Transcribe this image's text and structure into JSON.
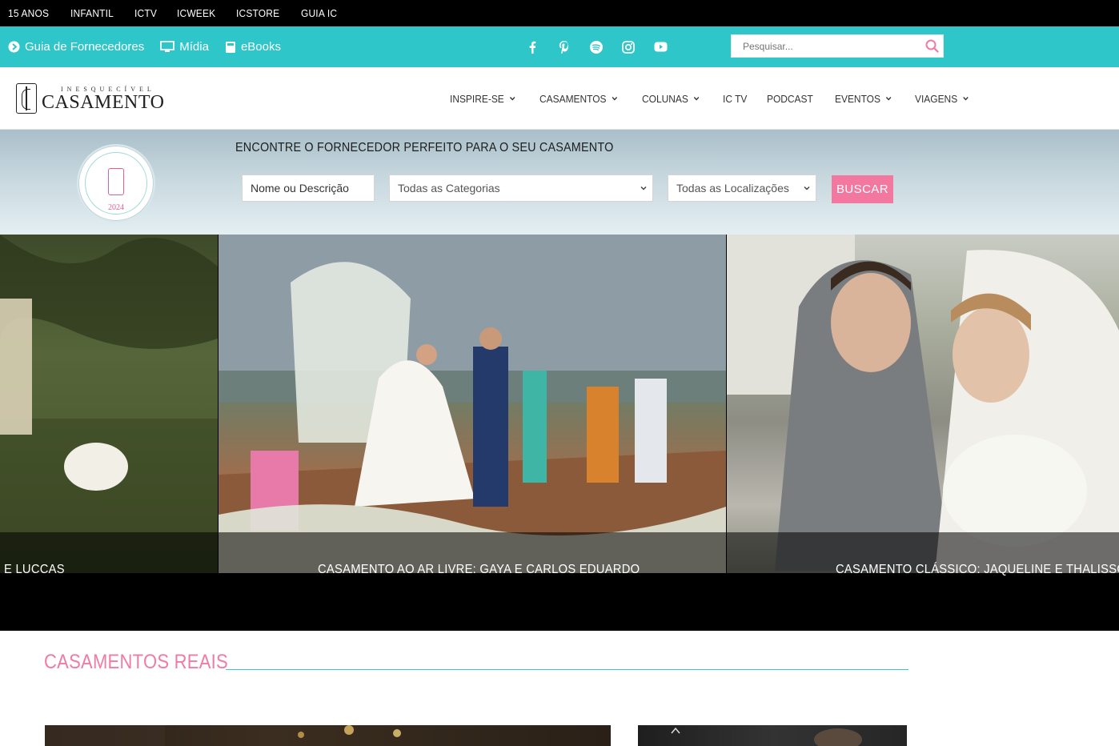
{
  "topbar": {
    "links": [
      "15 ANOS",
      "INFANTIL",
      "ICTV",
      "ICWEEK",
      "ICSTORE",
      "GUIA IC"
    ]
  },
  "tealbar": {
    "links": [
      {
        "label": "Guia de Fornecedores",
        "icon": "circle-arrow-icon"
      },
      {
        "label": "Mídia",
        "icon": "monitor-icon"
      },
      {
        "label": "eBooks",
        "icon": "book-icon"
      }
    ],
    "socials": [
      "facebook-icon",
      "pinterest-icon",
      "spotify-icon",
      "instagram-icon",
      "youtube-icon"
    ],
    "search_placeholder": "Pesquisar..."
  },
  "header": {
    "logo_small": "INESQUECÍVEL",
    "logo_big": "CASAMENTO",
    "nav": [
      {
        "label": "INSPIRE-SE",
        "dropdown": true
      },
      {
        "label": "CASAMENTOS",
        "dropdown": true
      },
      {
        "label": "COLUNAS",
        "dropdown": true
      },
      {
        "label": "IC TV",
        "dropdown": false
      },
      {
        "label": "PODCAST",
        "dropdown": false
      },
      {
        "label": "EVENTOS",
        "dropdown": true
      },
      {
        "label": "VIAGENS",
        "dropdown": true
      }
    ]
  },
  "supplier_search": {
    "title": "ENCONTRE O FORNECEDOR PERFEITO PARA O SEU CASAMENTO",
    "name_placeholder": "Nome ou Descrição",
    "category_value": "Todas as Categorias",
    "location_value": "Todas as Localizações",
    "button": "BUSCAR",
    "seal_year": "2024"
  },
  "carousel": {
    "captions": [
      "E LUCCAS",
      "CASAMENTO AO AR LIVRE: GAYA E CARLOS EDUARDO",
      "CASAMENTO CLÁSSICO: JAQUELINE E THALISSON"
    ]
  },
  "section": {
    "title": "CASAMENTOS REAIS"
  },
  "colors": {
    "teal": "#2fc6c9",
    "pink": "#f07ba3",
    "button_pink": "#f3789f"
  }
}
